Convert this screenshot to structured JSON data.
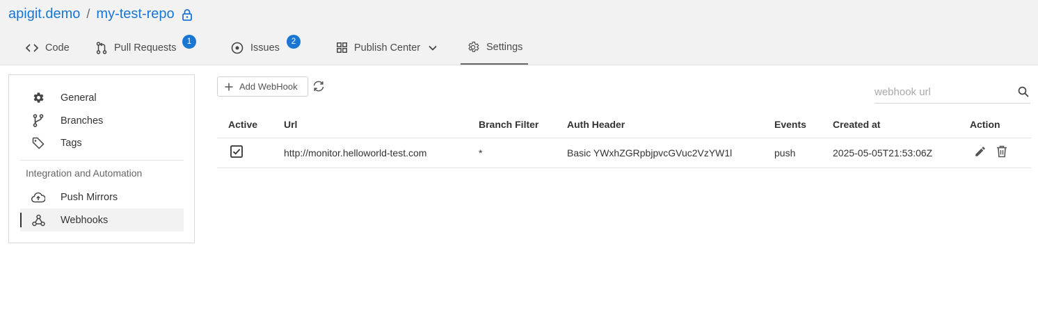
{
  "header": {
    "owner": "apigit.demo",
    "separator": "/",
    "repo": "my-test-repo"
  },
  "tabs": [
    {
      "label": "Code",
      "icon": "code-icon"
    },
    {
      "label": "Pull Requests",
      "icon": "pull-request-icon",
      "badge": "1"
    },
    {
      "label": "Issues",
      "icon": "issue-icon",
      "badge": "2"
    },
    {
      "label": "Publish Center",
      "icon": "grid-icon"
    },
    {
      "label": "Settings",
      "icon": "gear-icon",
      "active": true
    }
  ],
  "sidebar": {
    "items": [
      {
        "label": "General",
        "icon": "gear-icon"
      },
      {
        "label": "Branches",
        "icon": "branch-icon"
      },
      {
        "label": "Tags",
        "icon": "tag-icon"
      }
    ],
    "section_title": "Integration and Automation",
    "integration_items": [
      {
        "label": "Push Mirrors",
        "icon": "cloud-upload-icon"
      },
      {
        "label": "Webhooks",
        "icon": "webhook-icon",
        "selected": true
      }
    ]
  },
  "toolbar": {
    "add_label": "Add WebHook"
  },
  "search": {
    "placeholder": "webhook url",
    "value": ""
  },
  "table": {
    "columns": [
      "Active",
      "Url",
      "Branch Filter",
      "Auth Header",
      "Events",
      "Created at",
      "Action"
    ],
    "rows": [
      {
        "active": true,
        "url": "http://monitor.helloworld-test.com",
        "branch_filter": "*",
        "auth_header": "Basic YWxhZGRpbjpvcGVuc2VzYW1l",
        "events": "push",
        "created_at": "2025-05-05T21:53:06Z"
      }
    ]
  },
  "colors": {
    "accent": "#1976d2",
    "topbar_bg": "#f2f2f2"
  }
}
